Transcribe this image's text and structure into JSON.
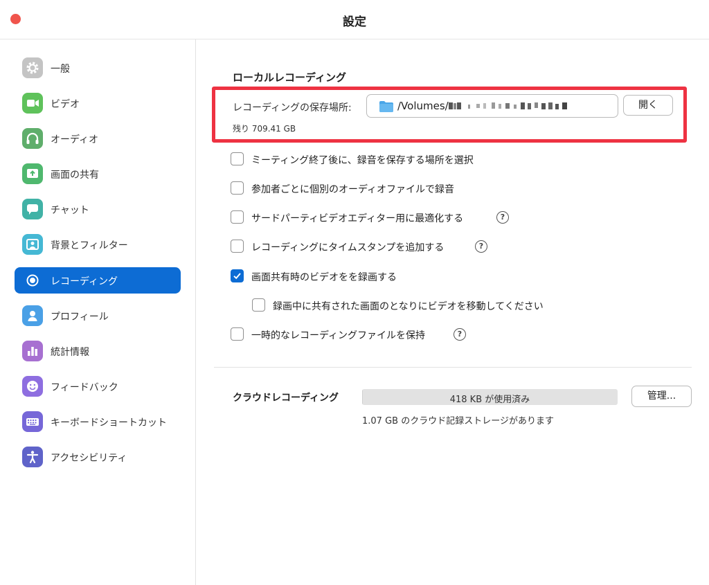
{
  "window": {
    "title": "設定"
  },
  "sidebar": {
    "items": [
      {
        "label": "一般",
        "icon": "gear-icon",
        "color": "#c4c4c4",
        "active": false
      },
      {
        "label": "ビデオ",
        "icon": "video-camera-icon",
        "color": "#5fc25b",
        "active": false
      },
      {
        "label": "オーディオ",
        "icon": "headphones-icon",
        "color": "#5fae6b",
        "active": false
      },
      {
        "label": "画面の共有",
        "icon": "share-screen-icon",
        "color": "#4fb86e",
        "active": false
      },
      {
        "label": "チャット",
        "icon": "chat-bubble-icon",
        "color": "#41b2a6",
        "active": false
      },
      {
        "label": "背景とフィルター",
        "icon": "background-person-icon",
        "color": "#45b8d4",
        "active": false
      },
      {
        "label": "レコーディング",
        "icon": "record-icon",
        "color": "#0d6cd4",
        "active": true
      },
      {
        "label": "プロフィール",
        "icon": "profile-icon",
        "color": "#4aa0e6",
        "active": false
      },
      {
        "label": "統計情報",
        "icon": "statistics-chart-icon",
        "color": "#a770d1",
        "active": false
      },
      {
        "label": "フィードバック",
        "icon": "smiley-icon",
        "color": "#8e6ee0",
        "active": false
      },
      {
        "label": "キーボードショートカット",
        "icon": "keyboard-icon",
        "color": "#7667d8",
        "active": false
      },
      {
        "label": "アクセシビリティ",
        "icon": "accessibility-icon",
        "color": "#5f63c9",
        "active": false
      }
    ]
  },
  "local": {
    "title": "ローカルレコーディング",
    "location_label": "レコーディングの保存場所:",
    "path_prefix": "/Volumes/",
    "open_button": "開く",
    "remaining": "残り 709.41 GB",
    "highlight_color": "#ee3242",
    "options": [
      {
        "label": "ミーティング終了後に、録音を保存する場所を選択",
        "checked": false,
        "help": false
      },
      {
        "label": "参加者ごとに個別のオーディオファイルで録音",
        "checked": false,
        "help": false
      },
      {
        "label": "サードパーティビデオエディター用に最適化する",
        "checked": false,
        "help": true
      },
      {
        "label": "レコーディングにタイムスタンプを追加する",
        "checked": false,
        "help": true
      },
      {
        "label": "画面共有時のビデオをを録画する",
        "checked": true,
        "help": false
      },
      {
        "label": "録画中に共有された画面のとなりにビデオを移動してください",
        "checked": false,
        "help": false
      },
      {
        "label": "一時的なレコーディングファイルを保持",
        "checked": false,
        "help": true
      }
    ]
  },
  "cloud": {
    "title": "クラウドレコーディング",
    "usage_text": "418 KB が使用済み",
    "usage_fraction": 0.0004,
    "manage_button": "管理...",
    "storage_text": "1.07 GB のクラウド記録ストレージがあります"
  },
  "help_glyph": "?"
}
